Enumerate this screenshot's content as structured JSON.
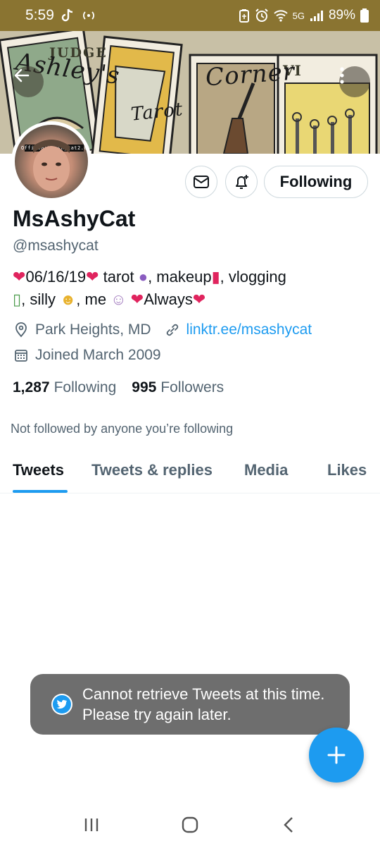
{
  "status_bar": {
    "time": "5:59",
    "battery": "89%",
    "network": "5G",
    "icons": [
      "tiktok-icon",
      "cast-icon",
      "battery-saver-icon",
      "alarm-icon",
      "wifi-icon",
      "signal-icon",
      "battery-icon"
    ]
  },
  "banner": {
    "title_part1": "Ashley's",
    "title_part2": "Corner",
    "title_part3": "Tarot",
    "card_judge": "JUDGE",
    "card_roman": "VI"
  },
  "avatar": {
    "tag_text": "OfficialMsashycat2.0"
  },
  "actions": {
    "following_label": "Following"
  },
  "profile": {
    "display_name": "MsAshyCat",
    "handle": "@msashycat",
    "bio_line1_a": "06/16/19",
    "bio_line1_b": " tarot ",
    "bio_line1_c": ", makeup",
    "bio_line1_d": ", vlogging",
    "bio_line2_a": ", silly ",
    "bio_line2_b": ", me ",
    "bio_line2_c": "Always",
    "location": "Park Heights, MD",
    "website": "linktr.ee/msashycat",
    "joined": "Joined March 2009"
  },
  "counts": {
    "following_count": "1,287",
    "following_label": "Following",
    "followers_count": "995",
    "followers_label": "Followers"
  },
  "social_context": "Not followed by anyone you’re following",
  "tabs": [
    {
      "label": "Tweets",
      "active": true
    },
    {
      "label": "Tweets & replies",
      "active": false
    },
    {
      "label": "Media",
      "active": false
    },
    {
      "label": "Likes",
      "active": false
    }
  ],
  "toast": {
    "message": "Cannot retrieve Tweets at this time. Please try again later."
  },
  "colors": {
    "accent": "#1d9bf0",
    "heart": "#e0245e",
    "status_bar": "#8a7431",
    "toast_bg": "#6e6e6e"
  }
}
